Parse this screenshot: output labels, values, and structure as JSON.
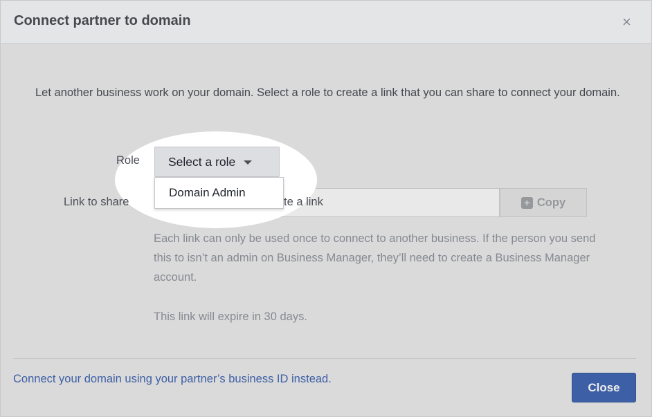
{
  "dialog": {
    "title": "Connect partner to domain",
    "close_icon": "×",
    "description": "Let another business work on your domain. Select a role to create a link that you can share to connect your domain."
  },
  "form": {
    "role_label": "Role",
    "role_select_value": "Select a role",
    "role_options": [
      "Domain Admin"
    ],
    "link_label": "Link to share",
    "link_placeholder_visible": "te a link",
    "copy_label": "Copy",
    "copy_icon": "copy-icon"
  },
  "help": {
    "text": "Each link can only be used once to connect to another business. If the person you send this to isn’t an admin on Business Manager, they’ll need to create a Business Manager account.",
    "expiry": "This link will expire in 30 days."
  },
  "footer": {
    "partner_link": "Connect your domain using your partner’s business ID instead.",
    "close_label": "Close"
  },
  "colors": {
    "accent": "#4267b2",
    "muted_text": "#90949c"
  }
}
